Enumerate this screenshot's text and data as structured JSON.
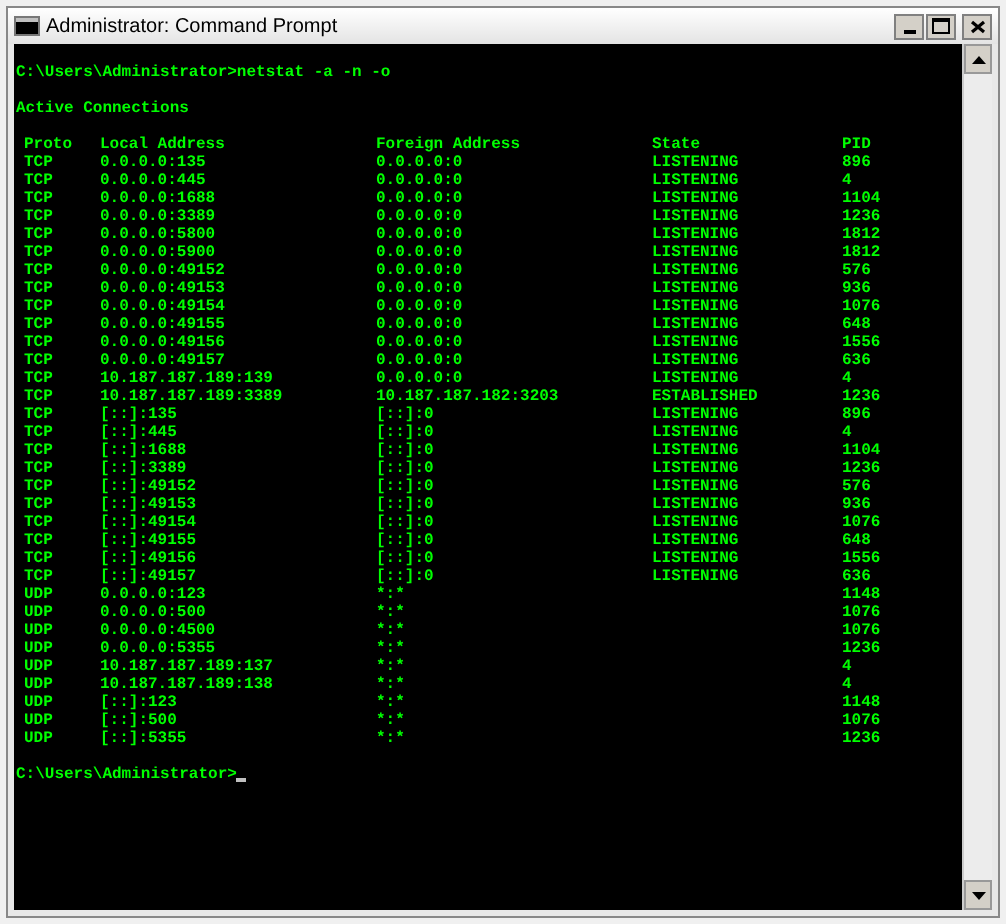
{
  "window": {
    "title": "Administrator: Command Prompt"
  },
  "console": {
    "command_line": "C:\\Users\\Administrator>netstat -a -n -o",
    "section_heading": "Active Connections",
    "columns": [
      "Proto",
      "Local Address",
      "Foreign Address",
      "State",
      "PID"
    ],
    "rows": [
      [
        "TCP",
        "0.0.0.0:135",
        "0.0.0.0:0",
        "LISTENING",
        "896"
      ],
      [
        "TCP",
        "0.0.0.0:445",
        "0.0.0.0:0",
        "LISTENING",
        "4"
      ],
      [
        "TCP",
        "0.0.0.0:1688",
        "0.0.0.0:0",
        "LISTENING",
        "1104"
      ],
      [
        "TCP",
        "0.0.0.0:3389",
        "0.0.0.0:0",
        "LISTENING",
        "1236"
      ],
      [
        "TCP",
        "0.0.0.0:5800",
        "0.0.0.0:0",
        "LISTENING",
        "1812"
      ],
      [
        "TCP",
        "0.0.0.0:5900",
        "0.0.0.0:0",
        "LISTENING",
        "1812"
      ],
      [
        "TCP",
        "0.0.0.0:49152",
        "0.0.0.0:0",
        "LISTENING",
        "576"
      ],
      [
        "TCP",
        "0.0.0.0:49153",
        "0.0.0.0:0",
        "LISTENING",
        "936"
      ],
      [
        "TCP",
        "0.0.0.0:49154",
        "0.0.0.0:0",
        "LISTENING",
        "1076"
      ],
      [
        "TCP",
        "0.0.0.0:49155",
        "0.0.0.0:0",
        "LISTENING",
        "648"
      ],
      [
        "TCP",
        "0.0.0.0:49156",
        "0.0.0.0:0",
        "LISTENING",
        "1556"
      ],
      [
        "TCP",
        "0.0.0.0:49157",
        "0.0.0.0:0",
        "LISTENING",
        "636"
      ],
      [
        "TCP",
        "10.187.187.189:139",
        "0.0.0.0:0",
        "LISTENING",
        "4"
      ],
      [
        "TCP",
        "10.187.187.189:3389",
        "10.187.187.182:3203",
        "ESTABLISHED",
        "1236"
      ],
      [
        "TCP",
        "[::]:135",
        "[::]:0",
        "LISTENING",
        "896"
      ],
      [
        "TCP",
        "[::]:445",
        "[::]:0",
        "LISTENING",
        "4"
      ],
      [
        "TCP",
        "[::]:1688",
        "[::]:0",
        "LISTENING",
        "1104"
      ],
      [
        "TCP",
        "[::]:3389",
        "[::]:0",
        "LISTENING",
        "1236"
      ],
      [
        "TCP",
        "[::]:49152",
        "[::]:0",
        "LISTENING",
        "576"
      ],
      [
        "TCP",
        "[::]:49153",
        "[::]:0",
        "LISTENING",
        "936"
      ],
      [
        "TCP",
        "[::]:49154",
        "[::]:0",
        "LISTENING",
        "1076"
      ],
      [
        "TCP",
        "[::]:49155",
        "[::]:0",
        "LISTENING",
        "648"
      ],
      [
        "TCP",
        "[::]:49156",
        "[::]:0",
        "LISTENING",
        "1556"
      ],
      [
        "TCP",
        "[::]:49157",
        "[::]:0",
        "LISTENING",
        "636"
      ],
      [
        "UDP",
        "0.0.0.0:123",
        "*:*",
        "",
        "1148"
      ],
      [
        "UDP",
        "0.0.0.0:500",
        "*:*",
        "",
        "1076"
      ],
      [
        "UDP",
        "0.0.0.0:4500",
        "*:*",
        "",
        "1076"
      ],
      [
        "UDP",
        "0.0.0.0:5355",
        "*:*",
        "",
        "1236"
      ],
      [
        "UDP",
        "10.187.187.189:137",
        "*:*",
        "",
        "4"
      ],
      [
        "UDP",
        "10.187.187.189:138",
        "*:*",
        "",
        "4"
      ],
      [
        "UDP",
        "[::]:123",
        "*:*",
        "",
        "1148"
      ],
      [
        "UDP",
        "[::]:500",
        "*:*",
        "",
        "1076"
      ],
      [
        "UDP",
        "[::]:5355",
        "*:*",
        "",
        "1236"
      ]
    ],
    "prompt": "C:\\Users\\Administrator>"
  }
}
